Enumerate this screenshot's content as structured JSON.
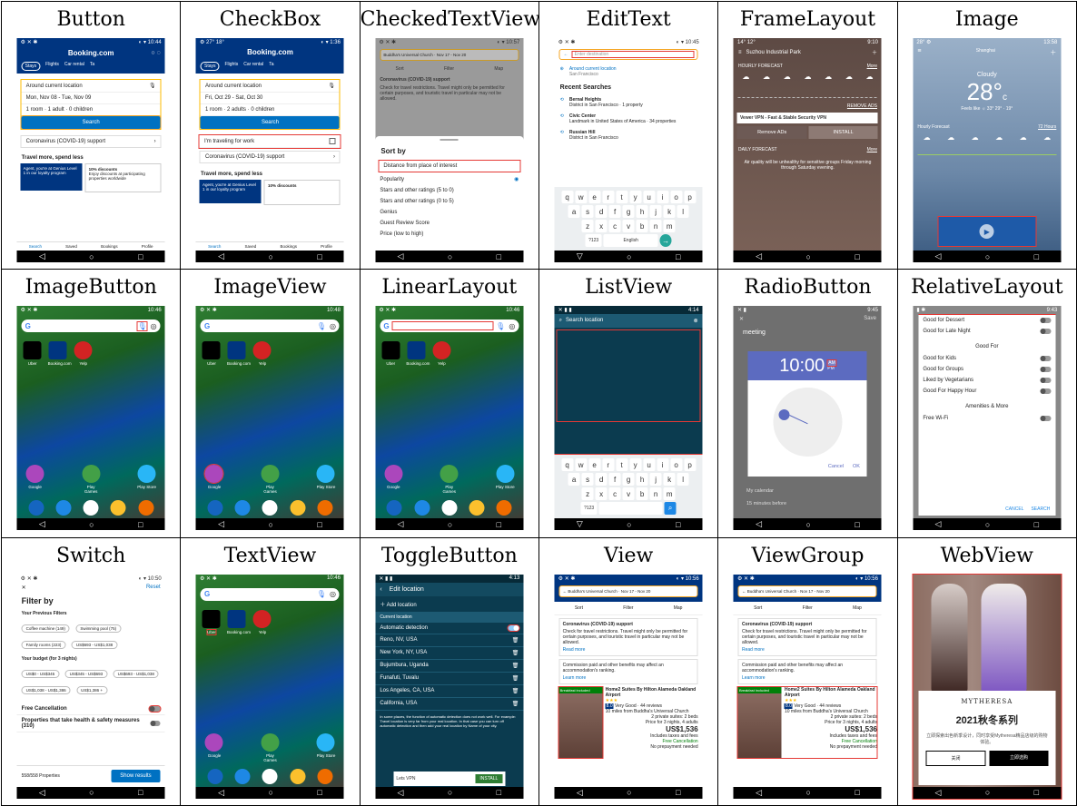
{
  "cells": [
    {
      "title": "Button"
    },
    {
      "title": "CheckBox"
    },
    {
      "title": "CheckedTextView"
    },
    {
      "title": "EditText"
    },
    {
      "title": "FrameLayout"
    },
    {
      "title": "Image"
    },
    {
      "title": "ImageButton"
    },
    {
      "title": "ImageView"
    },
    {
      "title": "LinearLayout"
    },
    {
      "title": "ListView"
    },
    {
      "title": "RadioButton"
    },
    {
      "title": "RelativeLayout"
    },
    {
      "title": "Switch"
    },
    {
      "title": "TextView"
    },
    {
      "title": "ToggleButton"
    },
    {
      "title": "View"
    },
    {
      "title": "ViewGroup"
    },
    {
      "title": "WebView"
    }
  ],
  "booking": {
    "brand": "Booking.com",
    "tabs": [
      "Stays",
      "Flights",
      "Car rental",
      "Ta"
    ],
    "location": "Around current location",
    "dates1": "Mon, Nov 08 - Tue, Nov 09",
    "dates2": "Fri, Oct 29 - Sat, Oct 30",
    "guests1": "1 room · 1 adult · 0 children",
    "guests2": "1 room · 2 adults · 0 children",
    "search": "Search",
    "covid": "Coronavirus (COVID-19) support",
    "travel_more": "Travel more, spend less",
    "genius": "Agent, you're at Genius Level 1 in our loyalty program",
    "discount": "10% discounts",
    "discount_sub": "Enjoy discounts at participating properties worldwide",
    "work": "I'm traveling for work",
    "nav": [
      "Search",
      "Saved",
      "Bookings",
      "Profile"
    ]
  },
  "checked": {
    "header": "Buddha's Universal Church · Nov 17 - Nov 20",
    "sort": "Sort",
    "filter": "Filter",
    "map": "Map",
    "covid": "Coronavirus (COVID-19) support",
    "covid_text": "Check for travel restrictions. Travel might only be permitted for certain purposes, and touristic travel in particular may not be allowed.",
    "sort_by": "Sort by",
    "options": [
      "Distance from place of interest",
      "Popularity",
      "Stars and other ratings (5 to 0)",
      "Stars and other ratings (0 to 5)",
      "Genius",
      "Guest Review Score",
      "Price (low to high)"
    ]
  },
  "edittext": {
    "placeholder": "Enter destination",
    "current": "Around current location",
    "current_sub": "San Francisco",
    "recent": "Recent Searches",
    "items": [
      {
        "name": "Bernal Heights",
        "sub": "District in San Francisco · 1 property"
      },
      {
        "name": "Civic Center",
        "sub": "Landmark in United States of America · 34 properties"
      },
      {
        "name": "Russian Hill",
        "sub": "District in San Francisco"
      }
    ],
    "keys1": [
      "q",
      "w",
      "e",
      "r",
      "t",
      "y",
      "u",
      "i",
      "o",
      "p"
    ],
    "keys2": [
      "a",
      "s",
      "d",
      "f",
      "g",
      "h",
      "j",
      "k",
      "l"
    ],
    "keys3": [
      "z",
      "x",
      "c",
      "v",
      "b",
      "n",
      "m"
    ],
    "lang": "English",
    "num": "?123"
  },
  "frame": {
    "city": "Suzhou Industrial Park",
    "hourly": "HOURLY FORECAST",
    "more": "More",
    "remove_ads": "REMOVE ADS",
    "ad_title": "Vewer VPN - Fast & Stable Security VPN",
    "ad_btn1": "Remove ADs",
    "ad_btn2": "INSTALL",
    "daily": "DAILY FORECAST",
    "air": "Air quality will be unhealthy for sensitive groups Friday morning through Saturday evening."
  },
  "image": {
    "city": "Shanghai",
    "cond": "Cloudy",
    "temp": "28°",
    "unit": "c",
    "feels": "Feels like ☼ 33°   29° · 19°",
    "hourly": "Hourly Forecast",
    "hours": "72 Hours"
  },
  "home": {
    "apps": [
      "Uber",
      "Booking.com",
      "Yelp"
    ],
    "folder": [
      "Google",
      "Play Games",
      "Play Store"
    ]
  },
  "listview": {
    "search": "Search location",
    "keys1": [
      "q",
      "w",
      "e",
      "r",
      "t",
      "y",
      "u",
      "i",
      "o",
      "p"
    ],
    "keys2": [
      "a",
      "s",
      "d",
      "f",
      "g",
      "h",
      "j",
      "k",
      "l"
    ],
    "keys3": [
      "z",
      "x",
      "c",
      "v",
      "b",
      "n",
      "m"
    ],
    "num": "?123"
  },
  "radio": {
    "save": "Save",
    "title": "meeting",
    "time": "10:00",
    "am": "AM",
    "pm": "PM",
    "cancel": "Cancel",
    "ok": "OK",
    "calendar": "My calendar",
    "reminder": "15 minutes before"
  },
  "relative": {
    "items1": [
      "Good for Dessert",
      "Good for Late Night"
    ],
    "good_for": "Good For",
    "items2": [
      "Good for Kids",
      "Good for Groups",
      "Liked by Vegetarians",
      "Good For Happy Hour"
    ],
    "amenities": "Amenities & More",
    "wifi": "Free Wi-Fi",
    "cancel": "CANCEL",
    "search": "SEARCH"
  },
  "switch": {
    "reset": "Reset",
    "filter_by": "Filter by",
    "prev": "Your Previous Filters",
    "chips1": [
      "Coffee machine (149)",
      "Swimming pool (75)",
      "Family rooms (223)",
      "US$693 - US$1,038"
    ],
    "budget": "Your budget (for 3 nights)",
    "chips2": [
      "US$0 - US$345",
      "US$345 - US$693",
      "US$693 - US$1,038",
      "US$1,038 - US$1,386",
      "US$1,386 +"
    ],
    "free_cancel": "Free Cancellation",
    "health": "Properties that take health & safety measures (310)",
    "count": "558/558 Properties",
    "show": "Show results"
  },
  "toggle": {
    "title": "Edit location",
    "add": "Add location",
    "current": "Current location",
    "auto": "Automatic detection",
    "places": [
      "Reno, NV, USA",
      "New York, NY, USA",
      "Bujumbura, Uganda",
      "Funafuti, Tuvalu",
      "Los Angeles, CA, USA",
      "California, USA"
    ],
    "footer": "In some places, the function of automatic detection does not work well. For example: Travel location is very far from your real location. In that case you can turn off automatic detection and then add your real location by Name of your city.",
    "ad": "Lets VPN",
    "install": "INSTALL"
  },
  "view": {
    "header": "Buddha's Universal Church · Nov 17 - Nov 20",
    "sort": "Sort",
    "filter": "Filter",
    "map": "Map",
    "covid": "Coronavirus (COVID-19) support",
    "covid_text": "Check for travel restrictions. Travel might only be permitted for certain purposes, and touristic travel in particular may not be allowed.",
    "read_more": "Read more",
    "commission": "Commission paid and other benefits may affect an accommodation's ranking.",
    "learn_more": "Learn more",
    "badge": "Breakfast included",
    "hotel": "Home2 Suites By Hilton Alameda Oakland Airport",
    "score": "8.0",
    "score_text": "Very Good · 44 reviews",
    "dist": "10 miles from Buddha's Universal Church",
    "beds": "2 private suites: 2 beds",
    "price_for": "Price for 3 nights, 4 adults",
    "price": "US$1,536",
    "taxes": "Includes taxes and fees",
    "free": "Free Cancellation",
    "no_prepay": "No prepayment needed"
  },
  "webview": {
    "brand": "MYTHERESA",
    "title": "2021秋冬系列",
    "text": "立即探索出色新季设计，同时享受Mytheresa精品店级的购物体验。",
    "close": "关闭",
    "buy": "立即选购"
  }
}
